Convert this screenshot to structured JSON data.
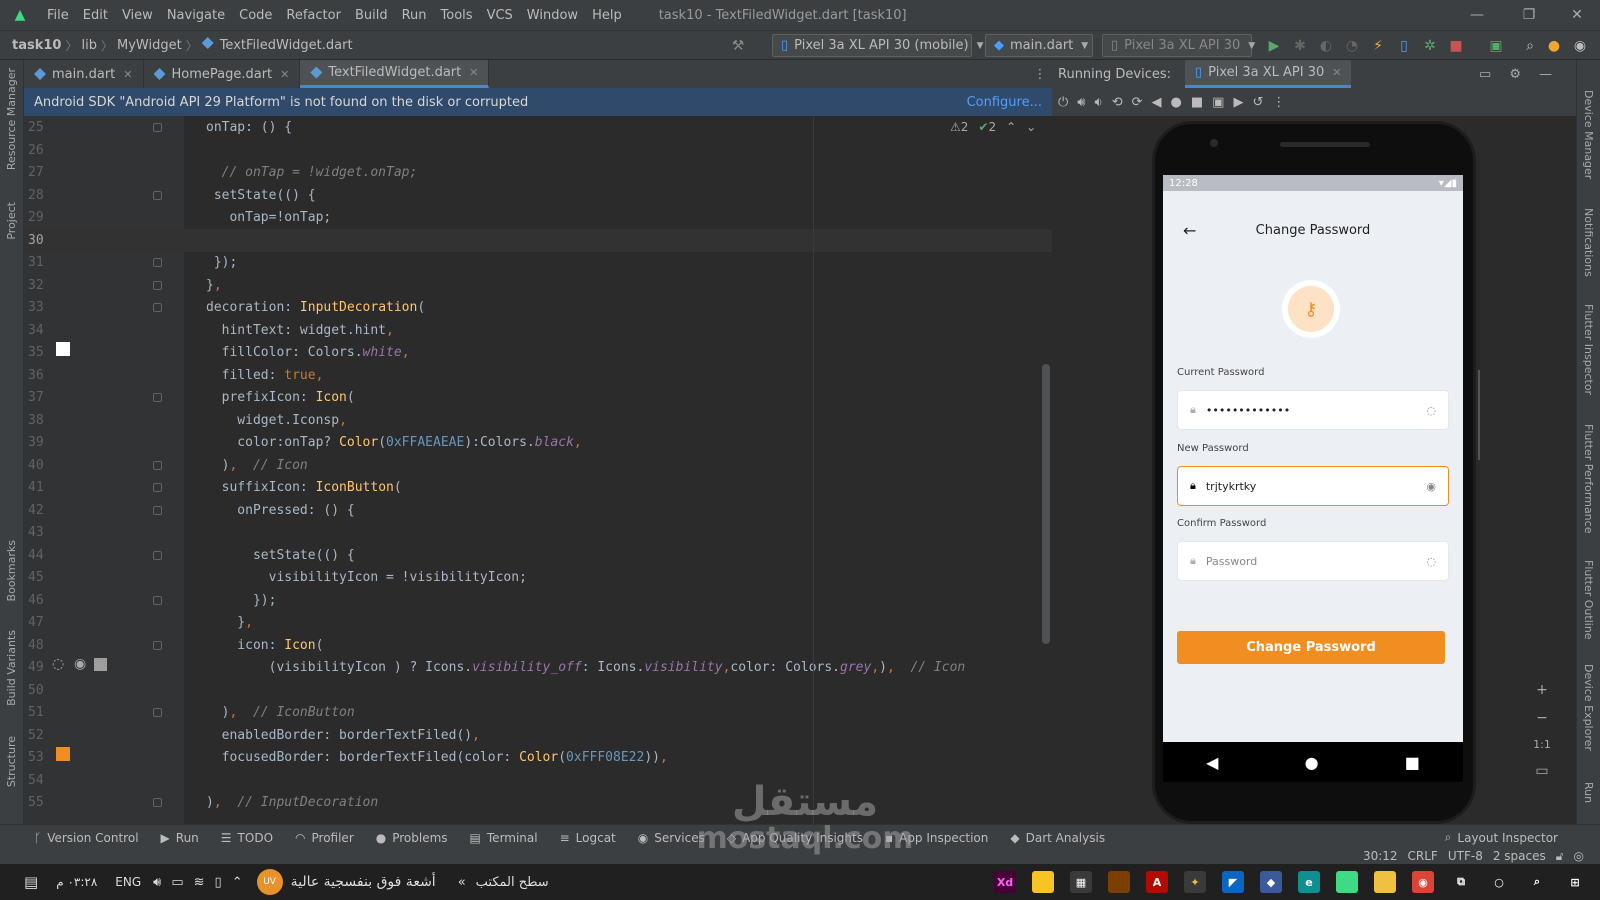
{
  "menubar": {
    "items": [
      "File",
      "Edit",
      "View",
      "Navigate",
      "Code",
      "Refactor",
      "Build",
      "Run",
      "Tools",
      "VCS",
      "Window",
      "Help"
    ],
    "title": "task10 - TextFiledWidget.dart [task10]"
  },
  "navbar": {
    "breadcrumbs": [
      "task10",
      "lib",
      "MyWidget",
      "TextFiledWidget.dart"
    ],
    "device_combo": "Pixel 3a XL API 30 (mobile)",
    "run_config": "main.dart",
    "device_combo_2": "Pixel 3a XL API 30"
  },
  "left_strip": {
    "labels": [
      "Resource Manager",
      "Project",
      "Bookmarks",
      "Build Variants",
      "Structure"
    ]
  },
  "right_strip": {
    "labels": [
      "Device Manager",
      "Notifications",
      "Flutter Inspector",
      "Flutter Performance",
      "Flutter Outline",
      "Device Explorer",
      "Run"
    ]
  },
  "editor_tabs": [
    {
      "label": "main.dart"
    },
    {
      "label": "HomePage.dart"
    },
    {
      "label": "TextFiledWidget.dart"
    }
  ],
  "banner": {
    "message": "Android SDK \"Android API 29 Platform\" is not found on the disk or corrupted",
    "link": "Configure..."
  },
  "inspections": {
    "warnings": "2",
    "ok": "2"
  },
  "code_lines": [
    {
      "n": "25",
      "t": "onTap: () {"
    },
    {
      "n": "26",
      "t": ""
    },
    {
      "n": "27",
      "t": "  // onTap = !widget.onTap;"
    },
    {
      "n": "28",
      "t": " setState(() {"
    },
    {
      "n": "29",
      "t": "   onTap=!onTap;"
    },
    {
      "n": "30",
      "t": ""
    },
    {
      "n": "31",
      "t": " });"
    },
    {
      "n": "32",
      "t": "},"
    },
    {
      "n": "33",
      "t": "decoration: InputDecoration("
    },
    {
      "n": "34",
      "t": "  hintText: widget.hint,"
    },
    {
      "n": "35",
      "t": "  fillColor: Colors.white,"
    },
    {
      "n": "36",
      "t": "  filled: true,"
    },
    {
      "n": "37",
      "t": "  prefixIcon: Icon("
    },
    {
      "n": "38",
      "t": "    widget.Iconsp,"
    },
    {
      "n": "39",
      "t": "    color:onTap? Color(0xFFAEAEAE):Colors.black,"
    },
    {
      "n": "40",
      "t": "  ),  // Icon"
    },
    {
      "n": "41",
      "t": "  suffixIcon: IconButton("
    },
    {
      "n": "42",
      "t": "    onPressed: () {"
    },
    {
      "n": "43",
      "t": ""
    },
    {
      "n": "44",
      "t": "      setState(() {"
    },
    {
      "n": "45",
      "t": "        visibilityIcon = !visibilityIcon;"
    },
    {
      "n": "46",
      "t": "      });"
    },
    {
      "n": "47",
      "t": "    },"
    },
    {
      "n": "48",
      "t": "    icon: Icon("
    },
    {
      "n": "49",
      "t": "        (visibilityIcon ) ? Icons.visibility_off: Icons.visibility,color: Colors.grey,),  // Icon"
    },
    {
      "n": "50",
      "t": ""
    },
    {
      "n": "51",
      "t": "  ),  // IconButton"
    },
    {
      "n": "52",
      "t": "  enabledBorder: borderTextFiled(),"
    },
    {
      "n": "53",
      "t": "  focusedBorder: borderTextFiled(color: Color(0xFFF08E22)),"
    },
    {
      "n": "54",
      "t": ""
    },
    {
      "n": "55",
      "t": "),  // InputDecoration"
    }
  ],
  "running_devices": {
    "label": "Running Devices:",
    "device_tab": "Pixel 3a XL API 30"
  },
  "phone": {
    "time": "12:28",
    "screen_title": "Change Password",
    "current_label": "Current Password",
    "current_value": "•••••••••••••",
    "new_label": "New Password",
    "new_value": "trjtykrtky",
    "confirm_label": "Confirm Password",
    "confirm_placeholder": "Password",
    "button": "Change Password",
    "accent": "#F08E22",
    "zoom_label": "1:1"
  },
  "bottom_tools": [
    "Version Control",
    "Run",
    "TODO",
    "Profiler",
    "Problems",
    "Terminal",
    "Logcat",
    "Services",
    "App Quality Insights",
    "App Inspection",
    "Dart Analysis"
  ],
  "layout_inspector": "Layout Inspector",
  "status": {
    "pos": "30:12",
    "eol": "CRLF",
    "enc": "UTF-8",
    "indent": "2 spaces"
  },
  "taskbar": {
    "time": "٠٣:٢٨ م",
    "lang": "ENG",
    "weather": "أشعة فوق بنفسجية عالية",
    "weather_badge": "UV",
    "desktop": "سطح المكتب"
  },
  "watermark": {
    "arabic": "مستقل",
    "latin": "mostaql.com"
  }
}
